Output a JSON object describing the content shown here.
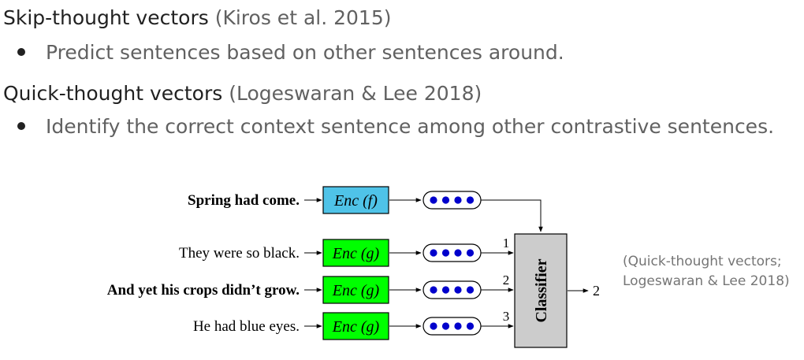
{
  "sections": [
    {
      "title": "Skip-thought vectors",
      "citation": "(Kiros et al. 2015)",
      "bullet": "Predict sentences based on other sentences around."
    },
    {
      "title": "Quick-thought vectors",
      "citation": "(Logeswaran & Lee 2018)",
      "bullet": "Identify the correct context sentence among other contrastive sentences."
    }
  ],
  "diagram": {
    "rows": [
      {
        "sentence": "Spring had come.",
        "encoder": "Enc (f)",
        "bold": true,
        "encoder_color": "#4fc3e8",
        "index_label": ""
      },
      {
        "sentence": "They were so black.",
        "encoder": "Enc (g)",
        "bold": false,
        "encoder_color": "#00ff00",
        "index_label": "1"
      },
      {
        "sentence": "And yet his crops didn’t grow.",
        "encoder": "Enc (g)",
        "bold": true,
        "encoder_color": "#00ff00",
        "index_label": "2"
      },
      {
        "sentence": "He had blue eyes.",
        "encoder": "Enc (g)",
        "bold": false,
        "encoder_color": "#00ff00",
        "index_label": "3"
      }
    ],
    "classifier_label": "Classifier",
    "output_label": "2",
    "vector_dot_color": "#0000cc",
    "classifier_color": "#cccccc"
  },
  "side_note": {
    "line1": "(Quick-thought vectors;",
    "line2": "Logeswaran & Lee 2018)"
  }
}
